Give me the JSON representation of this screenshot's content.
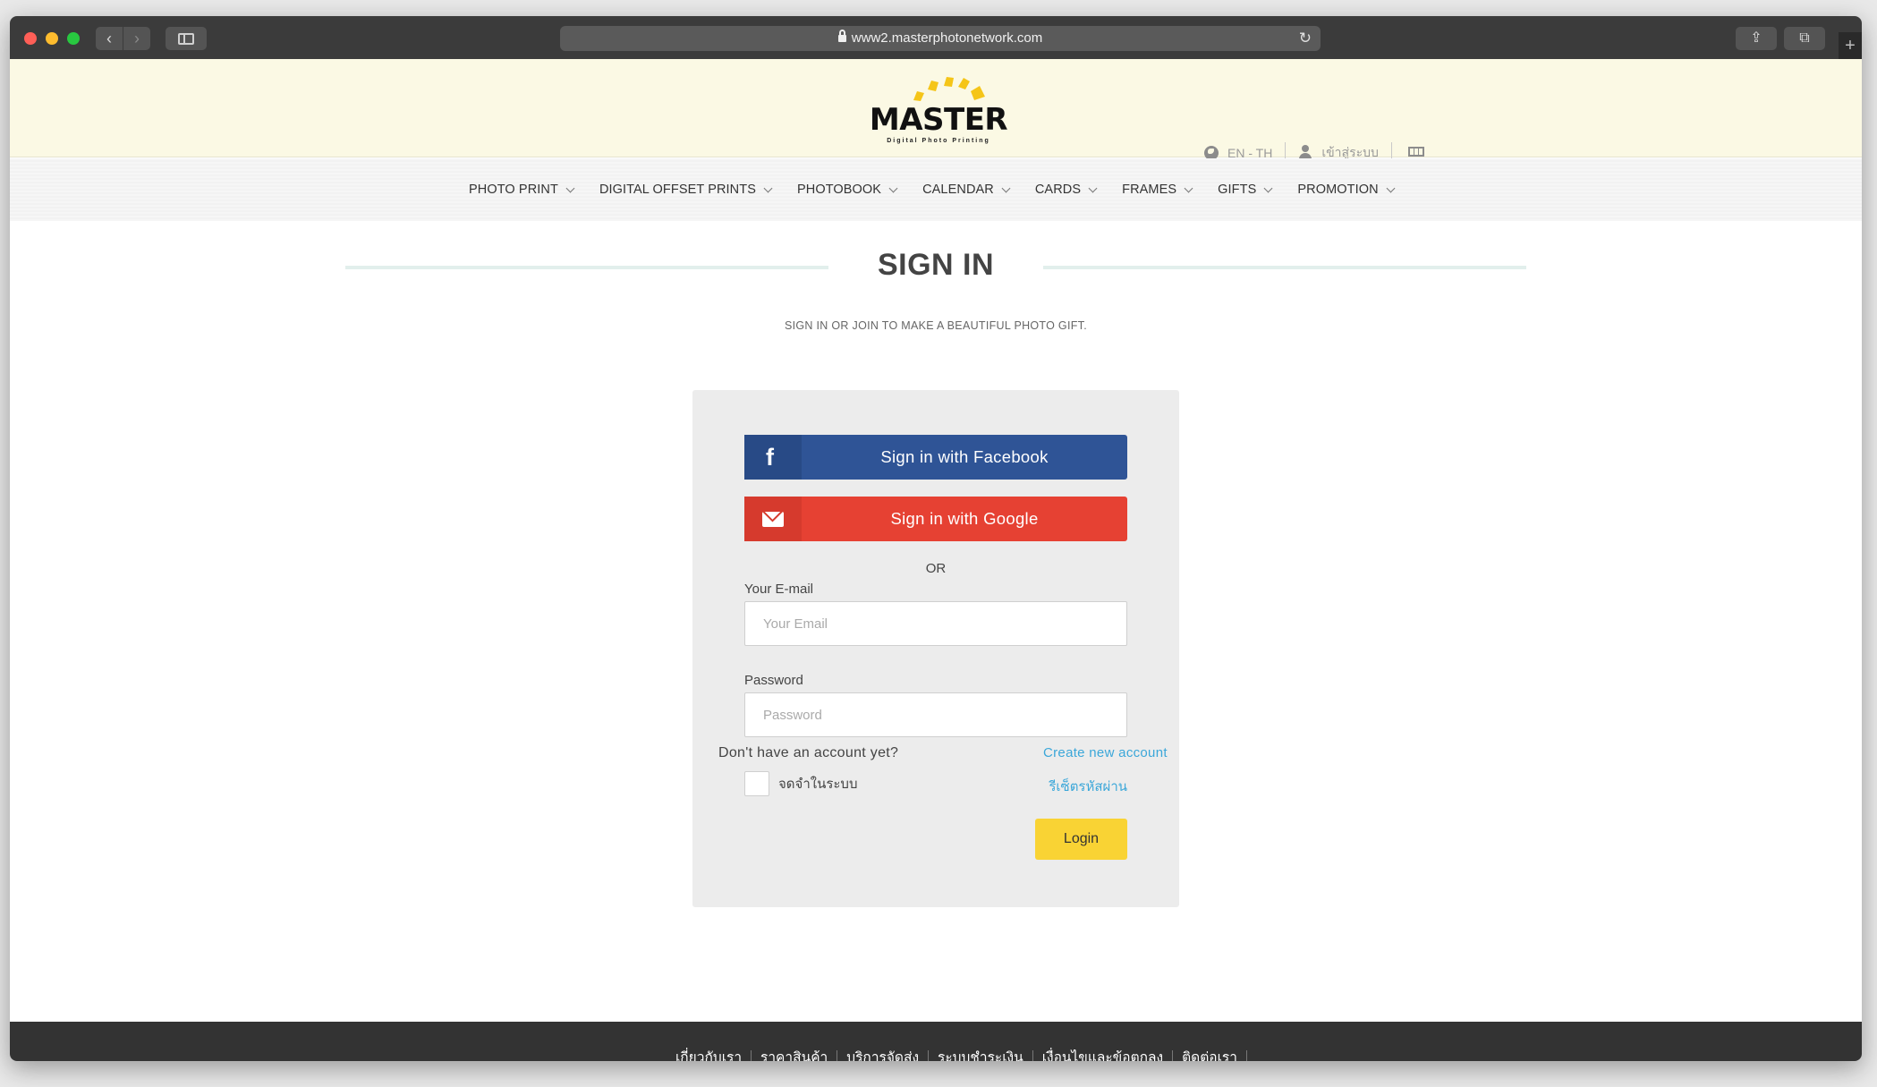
{
  "browser": {
    "url": "www2.masterphotonetwork.com",
    "back_glyph": "‹",
    "forward_glyph": "›",
    "reload_glyph": "↻",
    "share_glyph": "⇪",
    "tabs_glyph": "⧉",
    "newtab_glyph": "+"
  },
  "header": {
    "logo_text": "MASTER",
    "logo_sub": "Digital Photo Printing",
    "language": "EN - TH",
    "login_link": "เข้าสู่ระบบ"
  },
  "nav": {
    "items": [
      {
        "label": "PHOTO PRINT"
      },
      {
        "label": "DIGITAL OFFSET PRINTS"
      },
      {
        "label": "PHOTOBOOK"
      },
      {
        "label": "CALENDAR"
      },
      {
        "label": "CARDS"
      },
      {
        "label": "FRAMES"
      },
      {
        "label": "GIFTS"
      },
      {
        "label": "PROMOTION"
      }
    ]
  },
  "signin": {
    "title": "SIGN IN",
    "subtitle": "SIGN IN OR JOIN TO MAKE A BEAUTIFUL PHOTO GIFT.",
    "facebook_label": "Sign in with Facebook",
    "facebook_glyph": "f",
    "google_label": "Sign in with Google",
    "or_text": "OR",
    "email_label": "Your E-mail",
    "email_placeholder": "Your Email",
    "email_value": "",
    "password_label": "Password",
    "password_placeholder": "Password",
    "password_value": "",
    "remember_label": "จดจำในระบบ",
    "remember_checked": false,
    "forgot_label": "รีเซ็ตรหัสผ่าน",
    "login_label": "Login",
    "no_account_text": "Don't have an account yet?",
    "create_account_label": "Create new account"
  },
  "footer": {
    "links": [
      {
        "label": "เกี่ยวกับเรา"
      },
      {
        "label": "ราคาสินค้า"
      },
      {
        "label": "บริการจัดส่ง"
      },
      {
        "label": "ระบบชำระเงิน"
      },
      {
        "label": "เงื่อนไขและข้อตกลง"
      },
      {
        "label": "ติดต่อเรา"
      }
    ]
  },
  "colors": {
    "header_bg": "#fbf9e4",
    "facebook": "#2f5496",
    "google": "#e64133",
    "login_button": "#f9d334",
    "link": "#3ba7d9",
    "footer_bg": "#333333",
    "logo_accent": "#f5c518"
  }
}
